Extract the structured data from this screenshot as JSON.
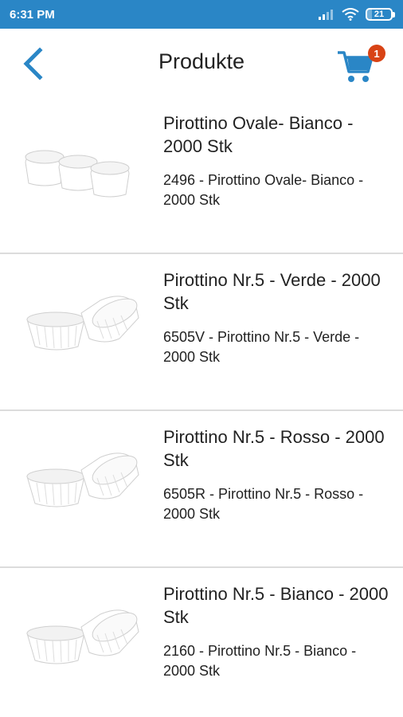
{
  "status_bar": {
    "time": "6:31 PM",
    "battery": "21",
    "battery_level_percent": 21
  },
  "app_bar": {
    "title": "Produkte",
    "cart_count": "1",
    "accent_color": "#2a86c6",
    "badge_color": "#d84315"
  },
  "products": [
    {
      "name": "Pirottino Ovale- Bianco - 2000 Stk",
      "description": "2496 - Pirottino Ovale- Bianco - 2000 Stk",
      "image": "oval-paper-cups"
    },
    {
      "name": "Pirottino Nr.5 - Verde - 2000 Stk",
      "description": "6505V - Pirottino Nr.5 - Verde - 2000 Stk",
      "image": "round-paper-cups"
    },
    {
      "name": "Pirottino Nr.5 - Rosso - 2000 Stk",
      "description": "6505R - Pirottino Nr.5 - Rosso - 2000 Stk",
      "image": "round-paper-cups"
    },
    {
      "name": "Pirottino Nr.5 - Bianco - 2000 Stk",
      "description": "2160 - Pirottino Nr.5 - Bianco - 2000 Stk",
      "image": "round-paper-cups"
    }
  ]
}
